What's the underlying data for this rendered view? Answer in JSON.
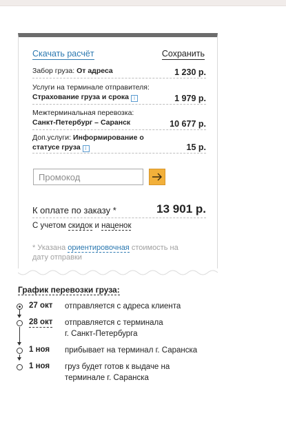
{
  "card": {
    "download_label": "Скачать расчёт",
    "save_label": "Сохранить",
    "rows": [
      {
        "label": "Забор груза",
        "value": "От адреса",
        "price": "1 230 р."
      },
      {
        "label": "Услуги на терминале отправителя",
        "value": "Страхование груза и срока",
        "price": "1 979 р."
      },
      {
        "label": "Межтерминальная перевозка",
        "value": "Санкт-Петербург – Саранск",
        "price": "10 677 р."
      },
      {
        "label": "Доп.услуги",
        "value_line1": "Информирование о",
        "value_line2": "статусе груза",
        "price": "15 р."
      }
    ],
    "info_icon": "i",
    "promo_placeholder": "Промокод",
    "total_label": "К оплате по заказу *",
    "total_value": "13 901 р.",
    "discounts_prefix": "С учетом",
    "discounts_link1": "скидок",
    "discounts_and": "и",
    "discounts_link2": "наценок",
    "note_prefix": "* Указана",
    "note_link": "ориентировочная",
    "note_suffix": "стоимость на дату отправки"
  },
  "schedule": {
    "title": "График перевозки груза:",
    "items": [
      {
        "date": "27 окт",
        "text": "отправляется с адреса клиента"
      },
      {
        "date": "28 окт",
        "text_line1": "отправляется с терминала",
        "text_line2": "г. Санкт-Петербурга"
      },
      {
        "date": "1 ноя",
        "text": "прибывает на терминал г. Саранска"
      },
      {
        "date": "1 ноя",
        "text_line1": "груз будет готов к выдаче на",
        "text_line2": "терминале г. Саранска"
      }
    ]
  },
  "colors": {
    "accent": "#f2b03a",
    "link": "#2b78b0",
    "header_bar": "#6c6c6c"
  }
}
